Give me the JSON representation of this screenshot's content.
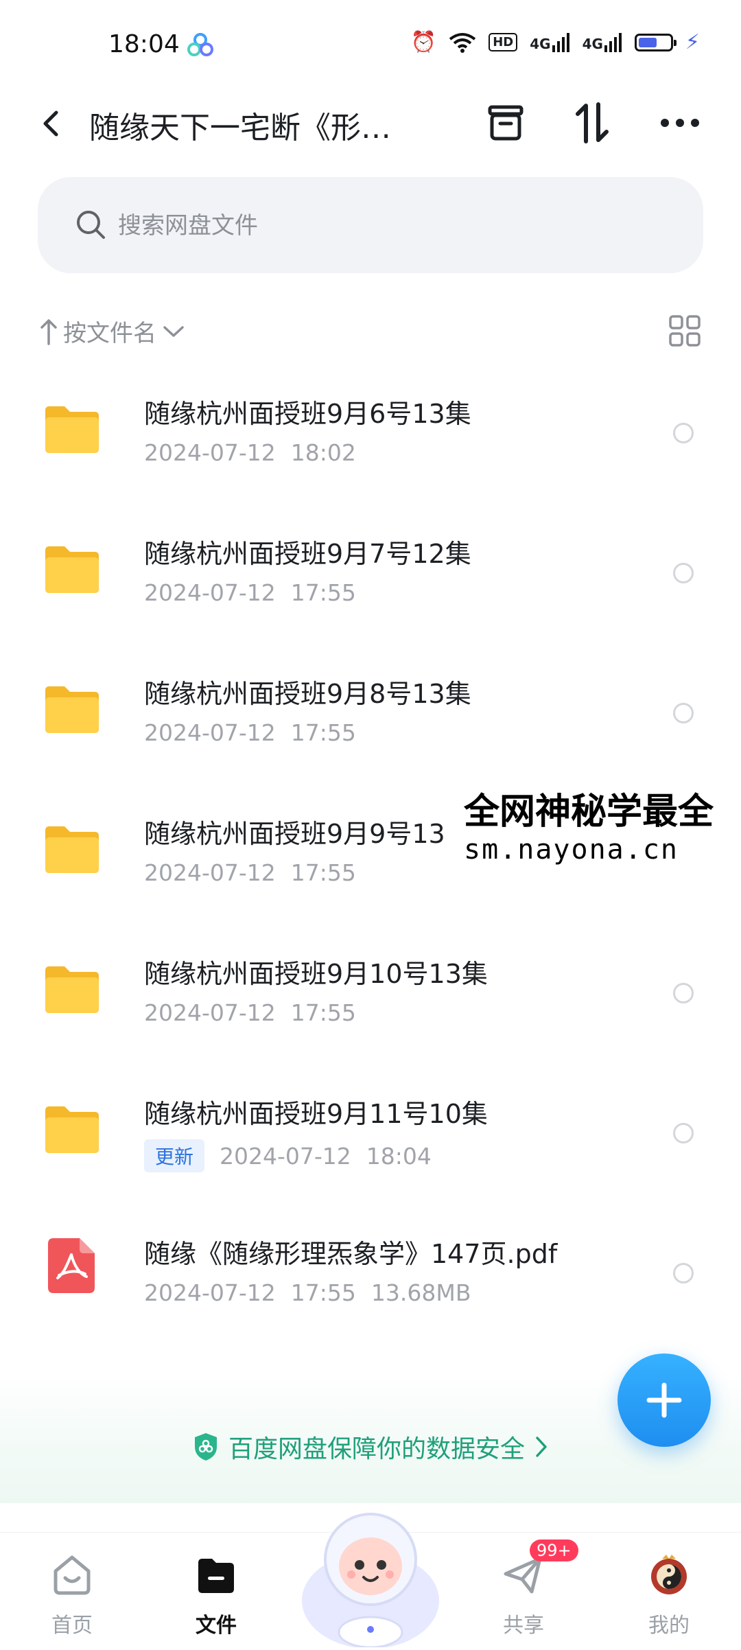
{
  "status_bar": {
    "time": "18:04",
    "hd_label": "HD",
    "signal_1": "4G",
    "signal_2": "4G",
    "battery_level": 0.6,
    "icons": [
      "baidu-cloud-icon",
      "alarm-icon",
      "wifi-icon",
      "hd-icon",
      "signal-icon",
      "signal-icon",
      "battery-icon",
      "charging-icon"
    ]
  },
  "header": {
    "title": "随缘天下一宅断《形…",
    "icons": [
      "back-icon",
      "recycle-icon",
      "sort-icon",
      "more-icon"
    ]
  },
  "search": {
    "placeholder": "搜索网盘文件"
  },
  "sort": {
    "label": "按文件名"
  },
  "files": [
    {
      "name": "随缘杭州面授班9月6号13集",
      "date": "2024-07-12",
      "time": "18:02",
      "type": "folder"
    },
    {
      "name": "随缘杭州面授班9月7号12集",
      "date": "2024-07-12",
      "time": "17:55",
      "type": "folder"
    },
    {
      "name": "随缘杭州面授班9月8号13集",
      "date": "2024-07-12",
      "time": "17:55",
      "type": "folder"
    },
    {
      "name": "随缘杭州面授班9月9号13",
      "date": "2024-07-12",
      "time": "17:55",
      "type": "folder"
    },
    {
      "name": "随缘杭州面授班9月10号13集",
      "date": "2024-07-12",
      "time": "17:55",
      "type": "folder"
    },
    {
      "name": "随缘杭州面授班9月11号10集",
      "tag": "更新",
      "date": "2024-07-12",
      "time": "18:04",
      "type": "folder"
    },
    {
      "name": "随缘《随缘形理炁象学》147页.pdf",
      "date": "2024-07-12",
      "time": "17:55",
      "size": "13.68MB",
      "type": "pdf"
    }
  ],
  "watermark": {
    "line1": "全网神秘学最全",
    "line2": "sm.nayona.cn"
  },
  "safety_banner": {
    "text": "百度网盘保障你的数据安全"
  },
  "bottom_nav": [
    {
      "label": "首页",
      "active": false
    },
    {
      "label": "文件",
      "active": true
    },
    {
      "label": "共享",
      "active": false,
      "badge": "99+"
    },
    {
      "label": "我的",
      "active": false
    }
  ],
  "colors": {
    "accent": "#1e8ef0",
    "safety_green": "#1fa07a",
    "folder_yellow": "#ffc93c",
    "pdf_red": "#f0555a",
    "badge_red": "#ff3b5c"
  }
}
